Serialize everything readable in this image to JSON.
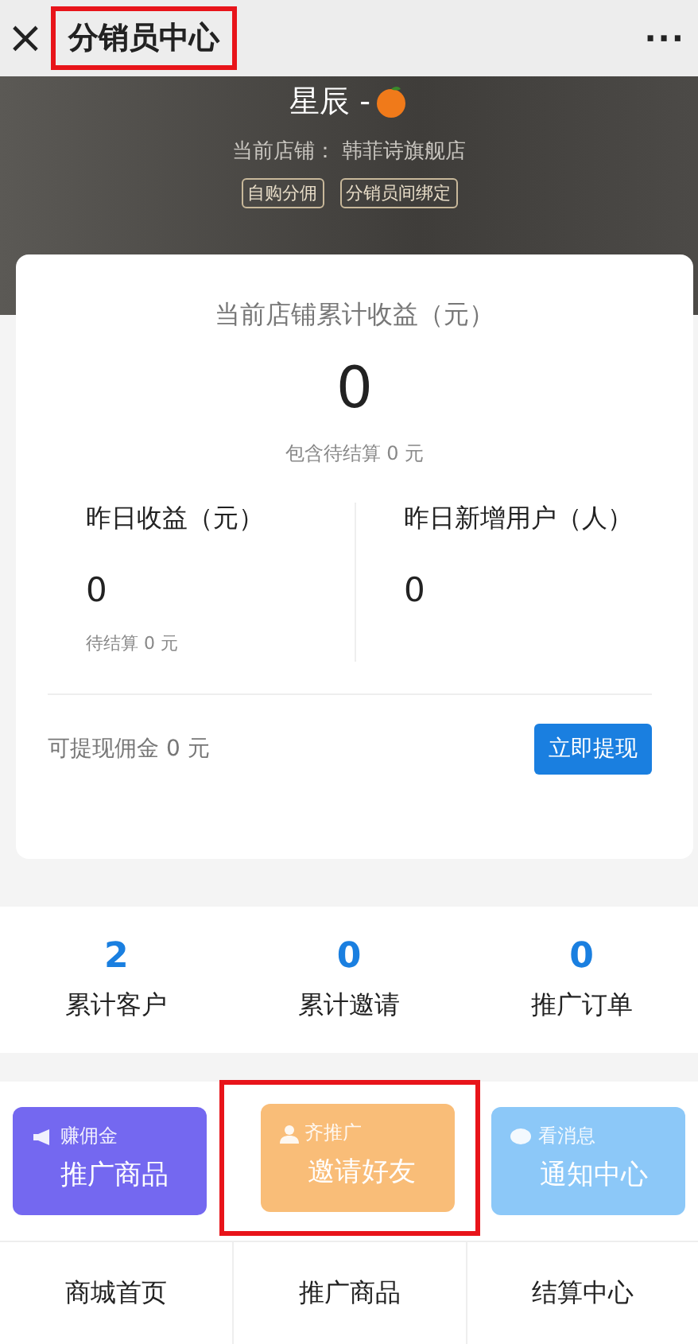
{
  "window": {
    "close_icon": "×",
    "title": "分销员中心",
    "title_highlighted": true,
    "more": "···"
  },
  "profile": {
    "name": "星辰 -",
    "store": "当前店铺： 韩菲诗旗舰店",
    "tags": [
      "自购分佣",
      "分销员间绑定"
    ]
  },
  "earnings": {
    "title": "当前店铺累计收益（元）",
    "total": "0",
    "pending_note": "包含待结算 0 元",
    "columns": [
      {
        "label": "昨日收益（元）",
        "value": "0",
        "note": "待结算 0 元"
      },
      {
        "label": "昨日新增用户（人）",
        "value": "0"
      }
    ],
    "withdrawable": "可提现佣金 0 元",
    "withdraw_button": "立即提现"
  },
  "stats": [
    {
      "value": "2",
      "label": "累计客户"
    },
    {
      "value": "0",
      "label": "累计邀请"
    },
    {
      "value": "0",
      "label": "推广订单"
    }
  ],
  "action_cards": [
    {
      "kind": "megaphone",
      "tag": "赚佣金",
      "title": "推广商品",
      "color": "#7468f0",
      "highlighted": false
    },
    {
      "kind": "person",
      "tag": "齐推广",
      "title": "邀请好友",
      "color": "#f9bd78",
      "highlighted": true
    },
    {
      "kind": "chat",
      "tag": "看消息",
      "title": "通知中心",
      "color": "#8cc8f8",
      "highlighted": false
    }
  ],
  "bottom_nav": [
    "商城首页",
    "推广商品",
    "结算中心"
  ]
}
